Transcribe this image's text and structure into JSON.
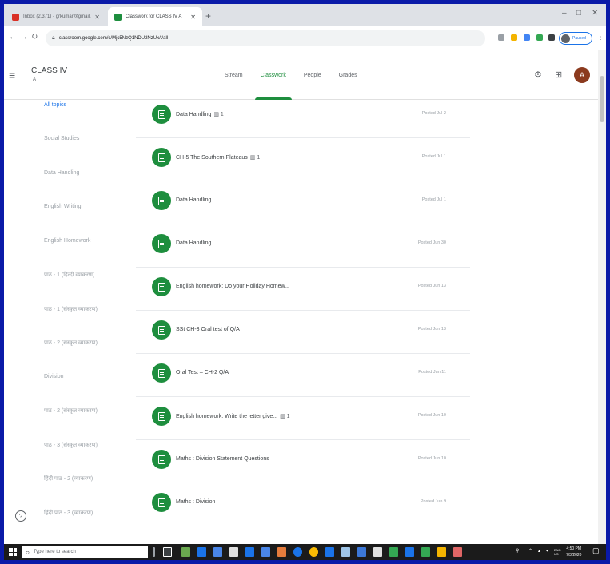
{
  "browser": {
    "tabs": [
      {
        "label": "Inbox (2,371) - grkumar@gmail.com",
        "active": false,
        "favicon_color": "#d93025"
      },
      {
        "label": "Classwork for CLASS IV A",
        "active": true,
        "favicon_color": "#1e8e3e"
      }
    ],
    "new_tab": "+",
    "window_controls": {
      "minimize": "–",
      "maximize": "□",
      "close": "✕"
    },
    "url": "classroom.google.com/c/Mjc5NzQ1NDU2NzUx/t/all",
    "profile_button": "Paused"
  },
  "app": {
    "class_name": "CLASS IV",
    "class_section": "A",
    "nav_tabs": [
      {
        "label": "Stream",
        "active": false
      },
      {
        "label": "Classwork",
        "active": true
      },
      {
        "label": "People",
        "active": false
      },
      {
        "label": "Grades",
        "active": false
      }
    ],
    "user_initial": "A",
    "accent": "#1e8e3e"
  },
  "sidebar": {
    "topics": [
      {
        "label": "All topics",
        "active": true
      },
      {
        "label": "Social Studies",
        "active": false
      },
      {
        "label": "Data Handling",
        "active": false
      },
      {
        "label": "English Writing",
        "active": false
      },
      {
        "label": "English Homework",
        "active": false
      },
      {
        "label": "पाठ - 1 (हिन्दी व्याकरण)",
        "active": false
      },
      {
        "label": "पाठ - 1 (संस्कृत व्याकरण)",
        "active": false
      },
      {
        "label": "पाठ - 2 (संस्कृत व्याकरण)",
        "active": false
      },
      {
        "label": "Division",
        "active": false
      },
      {
        "label": "पाठ - 2 (संस्कृत व्याकरण)",
        "active": false
      },
      {
        "label": "पाठ - 3 (संस्कृत व्याकरण)",
        "active": false
      },
      {
        "label": "हिंदी पाठ - 2 (व्याकरण)",
        "active": false
      },
      {
        "label": "हिंदी पाठ - 3 (व्याकरण)",
        "active": false
      }
    ]
  },
  "classwork": {
    "items": [
      {
        "title": "Data Handling",
        "tag": "▥ 1",
        "posted": "Posted Jul 2"
      },
      {
        "title": "CH-5 The Southern Plateaus",
        "tag": "▥ 1",
        "posted": "Posted Jul 1"
      },
      {
        "title": "Data Handling",
        "tag": "",
        "posted": "Posted Jul 1"
      },
      {
        "title": "Data Handling",
        "tag": "",
        "posted": "Posted Jun 30"
      },
      {
        "title": "English homework: Do your Holiday Homew...",
        "tag": "",
        "posted": "Posted Jun 13"
      },
      {
        "title": "SSt CH-3 Oral test of Q/A",
        "tag": "",
        "posted": "Posted Jun 13"
      },
      {
        "title": "Oral Test – CH-2 Q/A",
        "tag": "",
        "posted": "Posted Jun 11"
      },
      {
        "title": "English homework: Write the letter give...",
        "tag": "▥ 1",
        "posted": "Posted Jun 10"
      },
      {
        "title": "Maths : Division Statement Questions",
        "tag": "",
        "posted": "Posted Jun 10"
      },
      {
        "title": "Maths : Division",
        "tag": "",
        "posted": "Posted Jun 9"
      }
    ]
  },
  "taskbar": {
    "search_placeholder": "Type here to search",
    "tray_lang": "ENG",
    "tray_region": "US",
    "time": "4:50 PM",
    "date": "7/3/2020"
  }
}
